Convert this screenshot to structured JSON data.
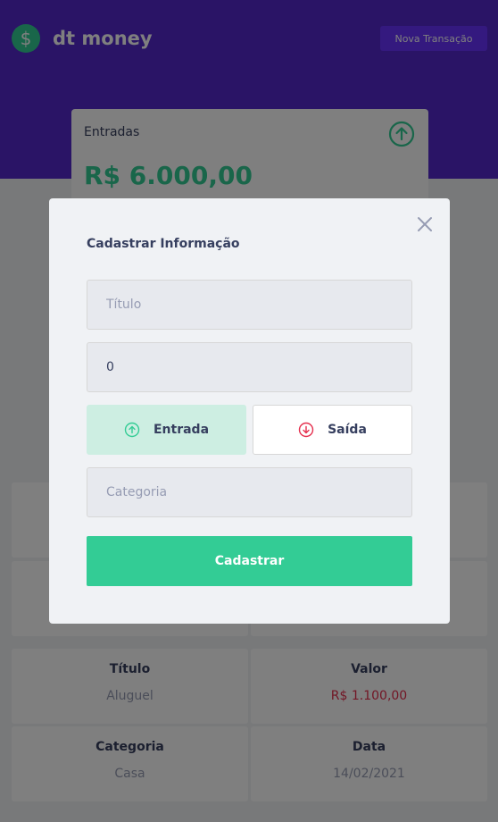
{
  "app": {
    "logo_symbol": "$",
    "title": "dt money",
    "new_transaction": "Nova Transação"
  },
  "summary": {
    "title": "Entradas",
    "value": "R$ 6.000,00",
    "icon": "arrow-up-circle-icon"
  },
  "table": {
    "headers": {
      "title": "Título",
      "value": "Valor",
      "category": "Categoria",
      "date": "Data"
    },
    "row": {
      "title": "Aluguel",
      "value": "R$ 1.100,00",
      "category": "Casa",
      "date": "14/02/2021"
    }
  },
  "modal": {
    "title": "Cadastrar Informação",
    "title_placeholder": "Título",
    "amount_value": "0",
    "income_label": "Entrada",
    "outcome_label": "Saída",
    "category_placeholder": "Categoria",
    "submit_label": "Cadastrar"
  },
  "colors": {
    "header": "#5429cc",
    "button": "#6933ff",
    "green": "#33cc95",
    "red": "#e52e4d",
    "income_selected": "#cdeee2"
  }
}
